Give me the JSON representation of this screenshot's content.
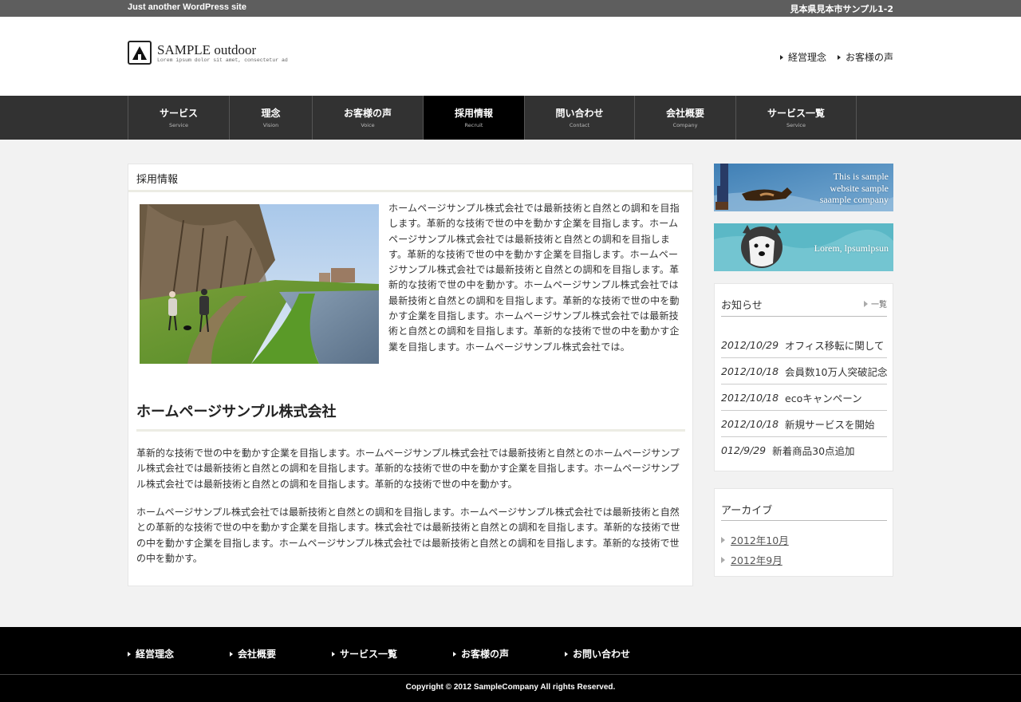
{
  "topbar": {
    "tagline": "Just another WordPress site",
    "address": "見本県見本市サンプル1-2"
  },
  "header": {
    "logo_title": "SAMPLE outdoor",
    "logo_sub": "Lorem ipsum dolor sit amet, consectetur ad",
    "links": [
      "経営理念",
      "お客様の声"
    ]
  },
  "nav": [
    {
      "jp": "サービス",
      "en": "Service"
    },
    {
      "jp": "理念",
      "en": "Vision"
    },
    {
      "jp": "お客様の声",
      "en": "Voice"
    },
    {
      "jp": "採用情報",
      "en": "Recruit",
      "active": true
    },
    {
      "jp": "問い合わせ",
      "en": "Contact"
    },
    {
      "jp": "会社概要",
      "en": "Company"
    },
    {
      "jp": "サービス一覧",
      "en": "Service"
    }
  ],
  "main": {
    "title": "採用情報",
    "intro": "ホームページサンプル株式会社では最新技術と自然との調和を目指します。革新的な技術で世の中を動かす企業を目指します。ホームページサンプル株式会社では最新技術と自然との調和を目指します。革新的な技術で世の中を動かす企業を目指します。ホームページサンプル株式会社では最新技術と自然との調和を目指します。革新的な技術で世の中を動かす。ホームページサンプル株式会社では最新技術と自然との調和を目指します。革新的な技術で世の中を動かす企業を目指します。ホームページサンプル株式会社では最新技術と自然との調和を目指します。革新的な技術で世の中を動かす企業を目指します。ホームページサンプル株式会社では。",
    "heading": "ホームページサンプル株式会社",
    "para1": "革新的な技術で世の中を動かす企業を目指します。ホームページサンプル株式会社では最新技術と自然とのホームページサンプル株式会社では最新技術と自然との調和を目指します。革新的な技術で世の中を動かす企業を目指します。ホームページサンプル株式会社では最新技術と自然との調和を目指します。革新的な技術で世の中を動かす。",
    "para2": "ホームページサンプル株式会社では最新技術と自然との調和を目指します。ホームページサンプル株式会社では最新技術と自然との革新的な技術で世の中を動かす企業を目指します。株式会社では最新技術と自然との調和を目指します。革新的な技術で世の中を動かす企業を目指します。ホームページサンプル株式会社では最新技術と自然との調和を目指します。革新的な技術で世の中を動かす。"
  },
  "sidebar": {
    "banner1": [
      "This is sample",
      "website sample",
      "saample company"
    ],
    "banner2": "Lorem, lpsumlpsun",
    "news": {
      "title": "お知らせ",
      "more": "一覧",
      "items": [
        {
          "date": "2012/10/29",
          "text": "オフィス移転に関して"
        },
        {
          "date": "2012/10/18",
          "text": "会員数10万人突破記念"
        },
        {
          "date": "2012/10/18",
          "text": "ecoキャンペーン"
        },
        {
          "date": "2012/10/18",
          "text": "新規サービスを開始"
        },
        {
          "date": "012/9/29",
          "text": "新着商品30点追加"
        }
      ]
    },
    "archive": {
      "title": "アーカイブ",
      "items": [
        "2012年10月",
        "2012年9月"
      ]
    }
  },
  "footer": {
    "links": [
      "経営理念",
      "会社概要",
      "サービス一覧",
      "お客様の声",
      "お問い合わせ"
    ],
    "copyright": "Copyright © 2012 SampleCompany All rights Reserved."
  }
}
